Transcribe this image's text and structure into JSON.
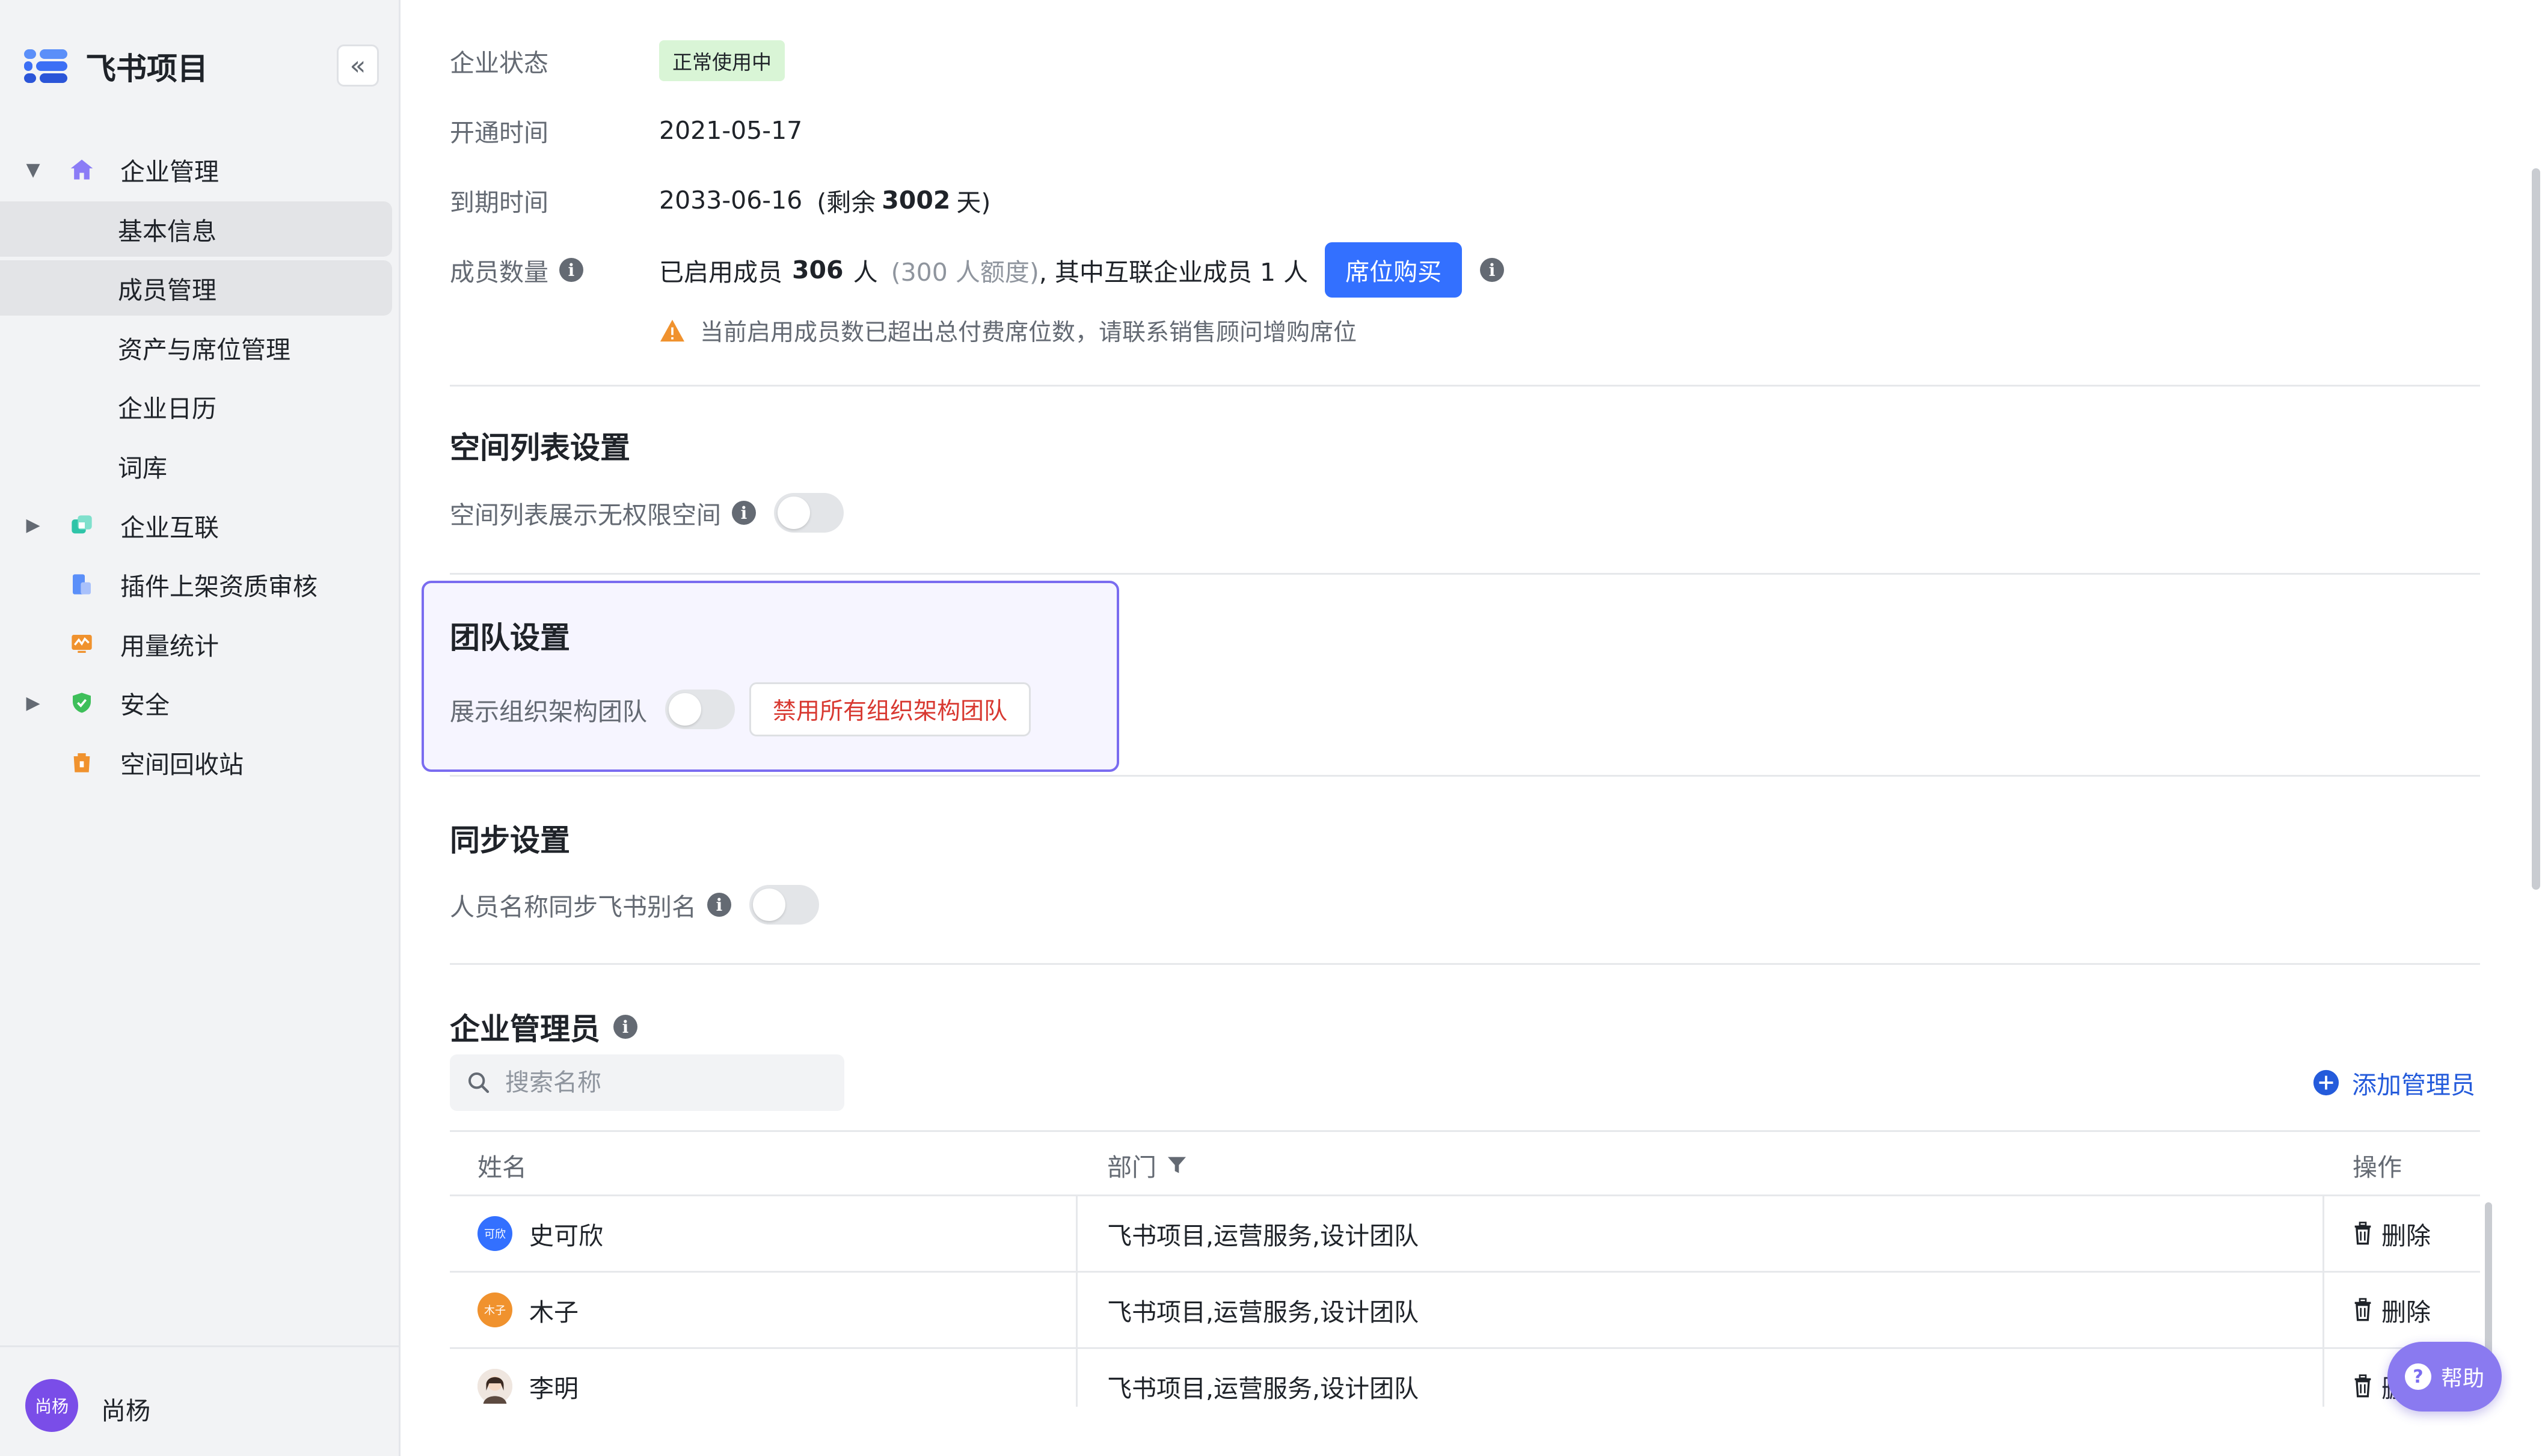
{
  "app": {
    "name": "飞书项目",
    "collapse_label": "«"
  },
  "sidebar": {
    "items": [
      {
        "label": "企业管理",
        "arrow": "▼"
      },
      {
        "label": "基本信息"
      },
      {
        "label": "成员管理"
      },
      {
        "label": "资产与席位管理"
      },
      {
        "label": "企业日历"
      },
      {
        "label": "词库"
      },
      {
        "label": "企业互联",
        "arrow": "▶"
      },
      {
        "label": "插件上架资质审核"
      },
      {
        "label": "用量统计"
      },
      {
        "label": "安全",
        "arrow": "▶"
      },
      {
        "label": "空间回收站"
      }
    ],
    "user": {
      "avatar_text": "尚杨",
      "name": "尚杨"
    }
  },
  "info": {
    "status_label": "企业状态",
    "status_value": "正常使用中",
    "open_label": "开通时间",
    "open_value": "2021-05-17",
    "expire_label": "到期时间",
    "expire_date": "2033-06-16",
    "expire_prefix": "(剩余",
    "expire_days": "3002",
    "expire_suffix": "天)",
    "members_label": "成员数量",
    "members_prefix": "已启用成员",
    "members_count": "306",
    "members_unit": "人",
    "members_quota": "(300 人额度)",
    "members_linked": ", 其中互联企业成员 1 人",
    "buy_seats": "席位购买",
    "warning": "当前启用成员数已超出总付费席位数，请联系销售顾问增购席位",
    "info_glyph": "i"
  },
  "space_settings": {
    "title": "空间列表设置",
    "toggle_label": "空间列表展示无权限空间"
  },
  "team_settings": {
    "title": "团队设置",
    "toggle_label": "展示组织架构团队",
    "disable_button": "禁用所有组织架构团队"
  },
  "sync_settings": {
    "title": "同步设置",
    "toggle_label": "人员名称同步飞书别名"
  },
  "admins": {
    "title": "企业管理员",
    "search_placeholder": "搜索名称",
    "add_button": "添加管理员",
    "columns": {
      "name": "姓名",
      "dept": "部门",
      "action": "操作"
    },
    "rows": [
      {
        "avatar_text": "可欣",
        "avatar_color": "#3370ff",
        "name": "史可欣",
        "dept": "飞书项目,运营服务,设计团队",
        "action": "删除"
      },
      {
        "avatar_text": "木子",
        "avatar_color": "#f0922e",
        "name": "木子",
        "dept": "飞书项目,运营服务,设计团队",
        "action": "删除"
      },
      {
        "avatar_text": "",
        "avatar_color": "#d9c5b8",
        "name": "李明",
        "dept": "飞书项目,运营服务,设计团队",
        "action": "删除"
      }
    ]
  },
  "help": {
    "label": "帮助",
    "glyph": "?"
  },
  "colors": {
    "accent": "#3370ff",
    "danger": "#d83931",
    "highlight_border": "#7a6cf0"
  }
}
